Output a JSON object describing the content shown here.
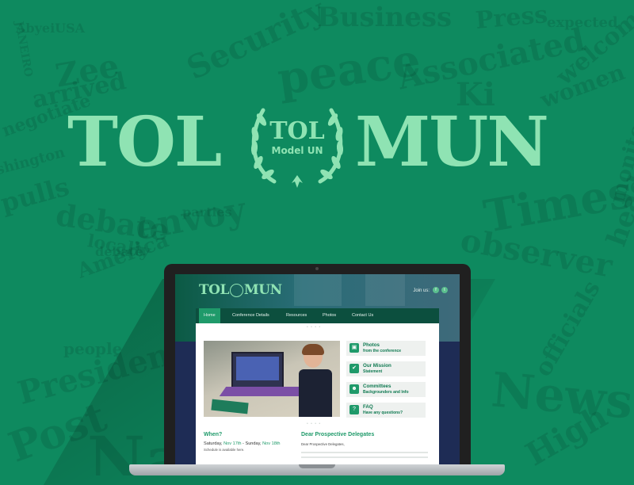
{
  "hero": {
    "left_word": "TOL",
    "right_word": "MUN",
    "emblem_title": "TOL",
    "emblem_subtitle": "Model UN"
  },
  "background_words": [
    "AbyeiUSA",
    "JANEIRO",
    "Zee",
    "arrived",
    "negotiate",
    "shington",
    "pulls",
    "debate",
    "envoy",
    "America",
    "Security",
    "peace",
    "Business",
    "Associated",
    "Press",
    "welcome",
    "expected",
    "women",
    "Ki",
    "Times",
    "observer",
    "monitors",
    "heads",
    "locally",
    "President",
    "Post",
    "Nations",
    "News",
    "High",
    "officials",
    "people",
    "debate",
    "parties"
  ],
  "site": {
    "logo_left": "TOL",
    "logo_right": "MUN",
    "join_label": "Join us:",
    "nav": [
      {
        "label": "Home",
        "active": true
      },
      {
        "label": "Conference Details",
        "active": false
      },
      {
        "label": "Resources",
        "active": false
      },
      {
        "label": "Photos",
        "active": false
      },
      {
        "label": "Contact Us",
        "active": false
      }
    ],
    "sidebar": [
      {
        "title": "Photos",
        "subtitle": "from the conference",
        "icon": "photo-icon"
      },
      {
        "title": "Our Mission",
        "subtitle": "Statement",
        "icon": "thumbs-up-icon"
      },
      {
        "title": "Committees",
        "subtitle": "Backgrounders and Info",
        "icon": "people-icon"
      },
      {
        "title": "FAQ",
        "subtitle": "Have any questions?",
        "icon": "question-icon"
      }
    ],
    "when": {
      "heading": "When?",
      "day1": "Saturday,",
      "date1": "Nov 17th",
      "separator": "- Sunday,",
      "date2": "Nov 18th",
      "note": "Schedule is available here."
    },
    "letter": {
      "heading": "Dear Prospective Delegates",
      "greeting": "Dear Prospective Delegates,"
    }
  },
  "colors": {
    "background": "#0e8a5f",
    "logo_mint": "#8fe3b3",
    "site_green": "#1f9a6a",
    "nav_dark": "#0c4f3e",
    "site_navy": "#1e2c55"
  }
}
